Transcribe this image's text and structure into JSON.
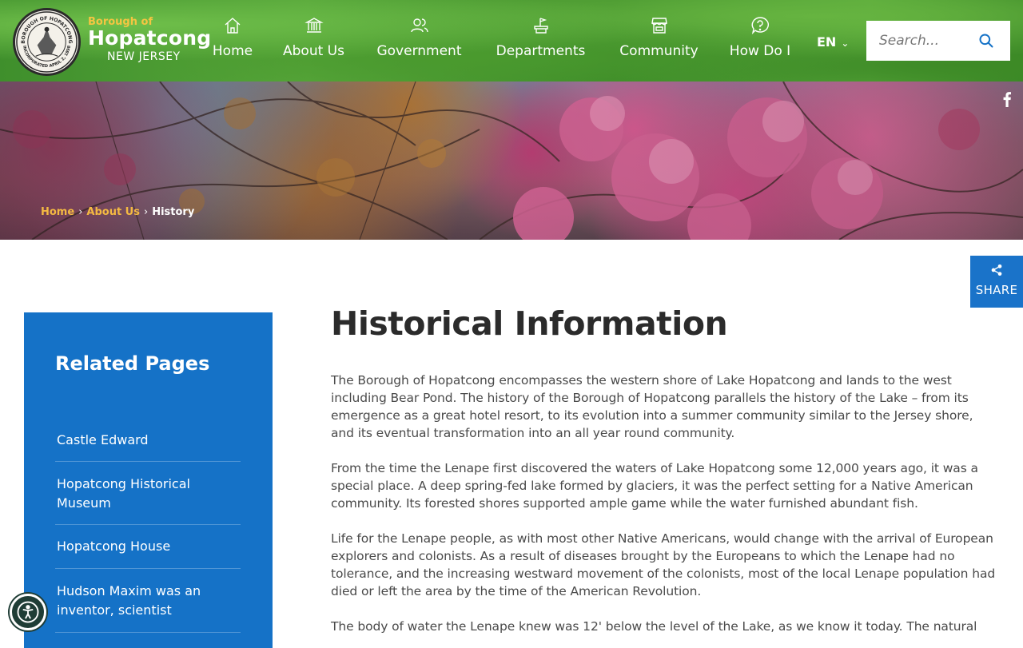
{
  "brand": {
    "prefix": "Borough of",
    "name": "Hopatcong",
    "state": "NEW JERSEY",
    "seal_text_top": "BOROUGH OF HOPATCONG",
    "seal_text_bottom": "INCORPORATED APRIL 2, 1898"
  },
  "nav": [
    {
      "label": "Home",
      "icon": "home-icon"
    },
    {
      "label": "About Us",
      "icon": "building-icon"
    },
    {
      "label": "Government",
      "icon": "users-icon"
    },
    {
      "label": "Departments",
      "icon": "flag-podium-icon"
    },
    {
      "label": "Community",
      "icon": "storefront-icon"
    },
    {
      "label": "How Do I",
      "icon": "question-icon"
    }
  ],
  "language": {
    "label": "EN"
  },
  "search": {
    "placeholder": "Search..."
  },
  "breadcrumb": {
    "home": "Home",
    "about": "About Us",
    "current": "History"
  },
  "share": {
    "label": "SHARE"
  },
  "sidebar": {
    "title": "Related Pages",
    "items": [
      "Castle Edward",
      "Hopatcong Historical Museum",
      "Hopatcong House",
      "Hudson Maxim was an inventor, scientist"
    ]
  },
  "main": {
    "title": "Historical Information",
    "paragraphs": [
      "The Borough of Hopatcong encompasses the western shore of Lake Hopatcong and lands to the west including Bear Pond. The history of the Borough of Hopatcong parallels the history of the Lake – from its emergence as a great hotel resort, to its evolution into a summer community similar to the Jersey shore, and its eventual transformation into an all year round community.",
      "From the time the Lenape first discovered the waters of Lake Hopatcong some 12,000 years ago, it was a special place. A deep spring-fed lake formed by glaciers, it was the perfect setting for a Native American community. Its forested shores supported ample game while the water furnished abundant fish.",
      "Life for the Lenape people, as with most other Native Americans, would change with the arrival of European explorers and colonists. As a result of diseases brought by the Europeans to which the Lenape had no tolerance, and the increasing westward movement of the colonists, most of the local Lenape population had died or left the area by the time of the American Revolution.",
      "The body of water the Lenape knew was 12' below the level of the Lake, as we know it today. The natural"
    ]
  },
  "colors": {
    "nav_green": "#4a9a32",
    "accent_blue": "#1572c7",
    "breadcrumb_gold": "#f4b942"
  }
}
